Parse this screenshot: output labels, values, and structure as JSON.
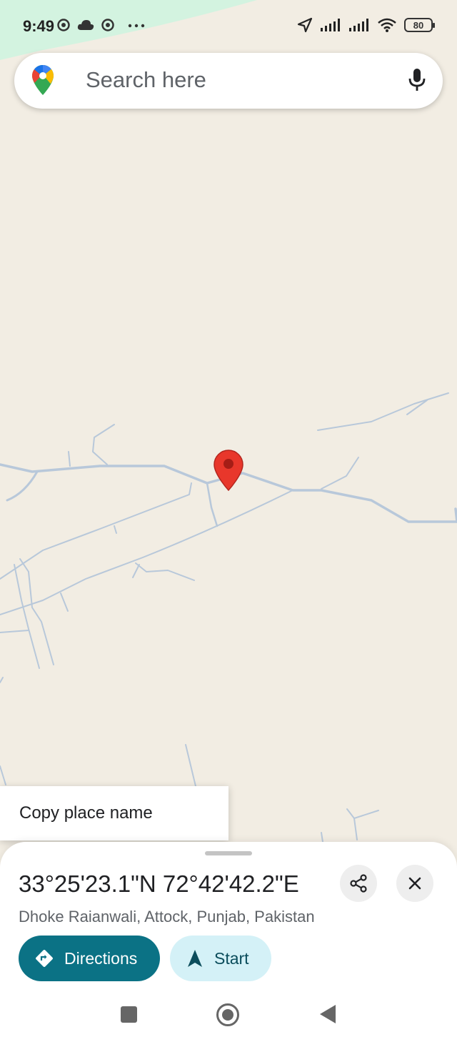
{
  "status_bar": {
    "time": "9:49",
    "left_icons": [
      "chrome-icon",
      "cloud-icon",
      "chrome-icon",
      "more-dots-icon"
    ],
    "right_icons": [
      "location-arrow-icon",
      "signal-icon",
      "signal-icon",
      "wifi-icon"
    ],
    "battery": "80"
  },
  "search": {
    "placeholder": "Search here",
    "logo_icon": "google-maps-logo",
    "mic_icon": "microphone-icon"
  },
  "context_menu": {
    "items": [
      {
        "label": "Copy place name"
      }
    ]
  },
  "place": {
    "coordinates": "33°25'23.1\"N 72°42'42.2\"E",
    "address": "Dhoke Raianwali, Attock, Punjab, Pakistan"
  },
  "actions": {
    "directions_label": "Directions",
    "start_label": "Start",
    "share_icon": "share-icon",
    "close_icon": "close-icon"
  },
  "colors": {
    "map_land": "#f2ede3",
    "park_green": "#d3f3e0",
    "road": "#b8c8d8",
    "pin_red": "#e8372b",
    "directions_teal": "#0b7285",
    "start_light": "#d4f1f7"
  },
  "nav": {
    "icons": [
      "recent-apps-icon",
      "home-icon",
      "back-icon"
    ]
  }
}
